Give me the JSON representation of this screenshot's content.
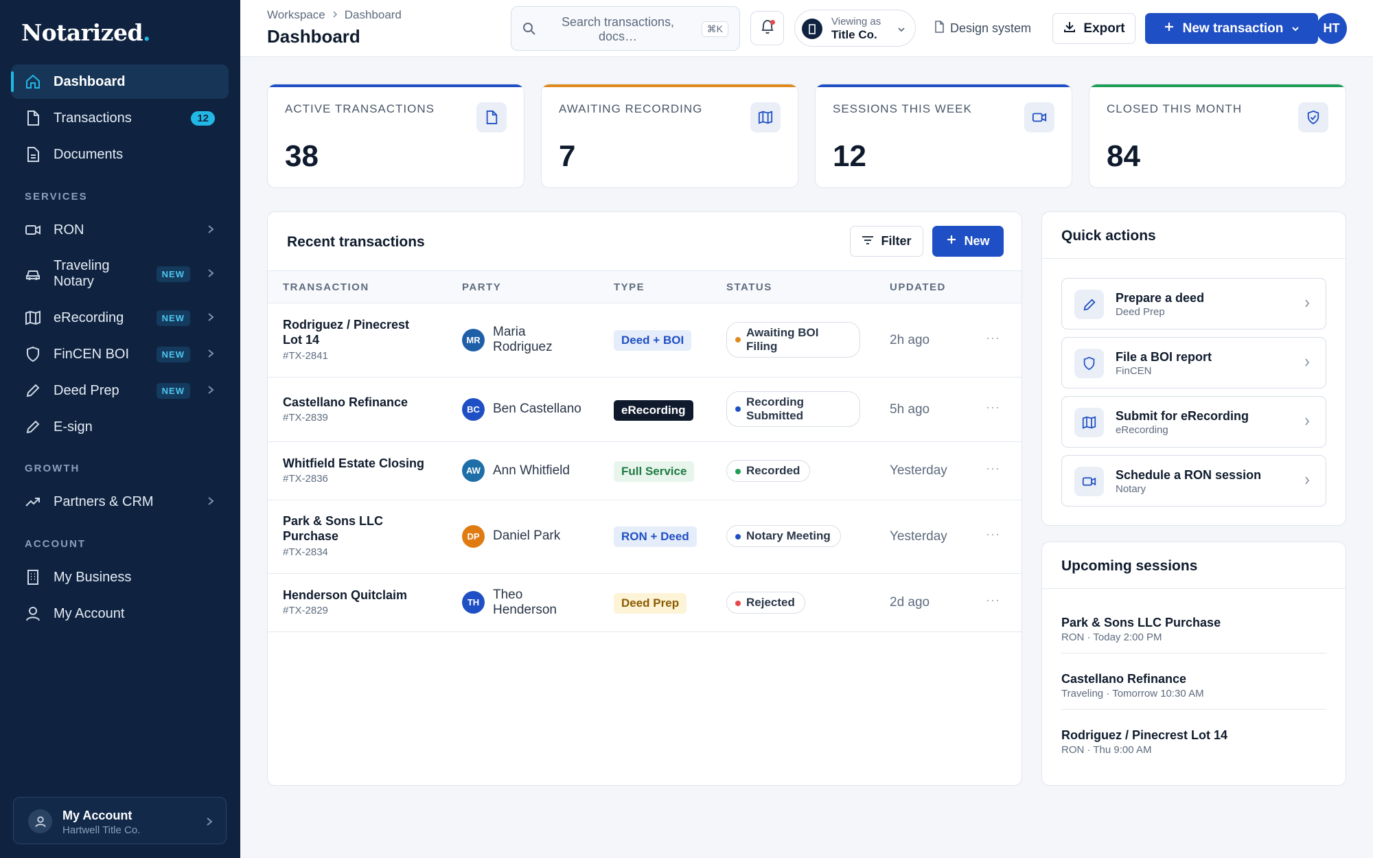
{
  "brand": {
    "name": "Notarized",
    "dot": ".",
    "accent": "#22b8e6"
  },
  "sidebar": {
    "items": [
      {
        "label": "Dashboard",
        "icon": "home-icon"
      },
      {
        "label": "Transactions",
        "icon": "file-icon",
        "count": "12"
      },
      {
        "label": "Documents",
        "icon": "document-icon"
      }
    ],
    "sections": [
      {
        "label": "SERVICES",
        "items": [
          {
            "label": "RON",
            "icon": "video-icon"
          },
          {
            "label": "Traveling Notary",
            "icon": "car-icon",
            "badge": "NEW"
          },
          {
            "label": "eRecording",
            "icon": "map-icon",
            "badge": "NEW"
          },
          {
            "label": "FinCEN BOI",
            "icon": "shield-icon",
            "badge": "NEW"
          },
          {
            "label": "Deed Prep",
            "icon": "pencil-icon",
            "badge": "NEW"
          },
          {
            "label": "E-sign",
            "icon": "pen-icon"
          }
        ]
      },
      {
        "label": "GROWTH",
        "items": [
          {
            "label": "Partners & CRM",
            "icon": "trending-up-icon"
          }
        ]
      },
      {
        "label": "ACCOUNT",
        "items": [
          {
            "label": "My Business",
            "icon": "building-icon"
          },
          {
            "label": "My Account",
            "icon": "user-icon"
          }
        ]
      }
    ],
    "account_card": {
      "name": "My Account",
      "org": "Hartwell Title Co."
    }
  },
  "header": {
    "breadcrumb": [
      "Workspace",
      "Dashboard"
    ],
    "title": "Dashboard",
    "search_placeholder": "Search transactions, docs…",
    "search_shortcut": "⌘K",
    "viewing_label": "Viewing as",
    "viewing_value": "Title Co.",
    "design_link": "Design system",
    "export_label": "Export",
    "new_tx_label": "New transaction",
    "user_initials": "HT"
  },
  "stats": [
    {
      "label": "ACTIVE TRANSACTIONS",
      "value": "38",
      "color": "#1f4fc4",
      "icon": "file-icon"
    },
    {
      "label": "AWAITING RECORDING",
      "value": "7",
      "color": "#e08a1e",
      "icon": "map-icon"
    },
    {
      "label": "SESSIONS THIS WEEK",
      "value": "12",
      "color": "#1f4fc4",
      "icon": "video-icon"
    },
    {
      "label": "CLOSED THIS MONTH",
      "value": "84",
      "color": "#1f9d55",
      "icon": "shield-check-icon"
    }
  ],
  "recent": {
    "title": "Recent transactions",
    "filter_label": "Filter",
    "new_label": "New",
    "columns": [
      "TRANSACTION",
      "PARTY",
      "TYPE",
      "STATUS",
      "UPDATED"
    ],
    "rows": [
      {
        "name": "Rodriguez / Pinecrest Lot 14",
        "id": "#TX-2841",
        "initials": "MR",
        "avatar_color": "#1e5fa8",
        "party": "Maria Rodriguez",
        "type": "Deed + BOI",
        "status": "Awaiting BOI Filing",
        "status_color": "#e08a1e",
        "updated": "2h ago"
      },
      {
        "name": "Castellano Refinance",
        "id": "#TX-2839",
        "initials": "BC",
        "avatar_color": "#1f4fc4",
        "party": "Ben Castellano",
        "type": "eRecording",
        "status": "Recording Submitted",
        "status_color": "#1f4fc4",
        "updated": "5h ago"
      },
      {
        "name": "Whitfield Estate Closing",
        "id": "#TX-2836",
        "initials": "AW",
        "avatar_color": "#1e6fa8",
        "party": "Ann Whitfield",
        "type": "Full Service",
        "status": "Recorded",
        "status_color": "#1f9d55",
        "updated": "Yesterday"
      },
      {
        "name": "Park & Sons LLC Purchase",
        "id": "#TX-2834",
        "initials": "DP",
        "avatar_color": "#e07b12",
        "party": "Daniel Park",
        "type": "RON + Deed",
        "status": "Notary Meeting",
        "status_color": "#1f4fc4",
        "updated": "Yesterday"
      },
      {
        "name": "Henderson Quitclaim",
        "id": "#TX-2829",
        "initials": "TH",
        "avatar_color": "#1f4fc4",
        "party": "Theo Henderson",
        "type": "Deed Prep",
        "status": "Rejected",
        "status_color": "#e5484d",
        "updated": "2d ago"
      }
    ],
    "more": "···"
  },
  "quick": {
    "title": "Quick actions",
    "items": [
      {
        "title": "Prepare a deed",
        "sub": "Deed Prep",
        "icon": "pencil-icon"
      },
      {
        "title": "File a BOI report",
        "sub": "FinCEN",
        "icon": "shield-icon"
      },
      {
        "title": "Submit for eRecording",
        "sub": "eRecording",
        "icon": "map-icon"
      },
      {
        "title": "Schedule a RON session",
        "sub": "Notary",
        "icon": "video-icon"
      }
    ]
  },
  "upcoming": {
    "title": "Upcoming sessions",
    "items": [
      {
        "title": "Park & Sons LLC Purchase",
        "sub": "RON · Today 2:00 PM"
      },
      {
        "title": "Castellano Refinance",
        "sub": "Traveling · Tomorrow 10:30 AM"
      },
      {
        "title": "Rodriguez / Pinecrest Lot 14",
        "sub": "RON · Thu 9:00 AM"
      }
    ]
  }
}
